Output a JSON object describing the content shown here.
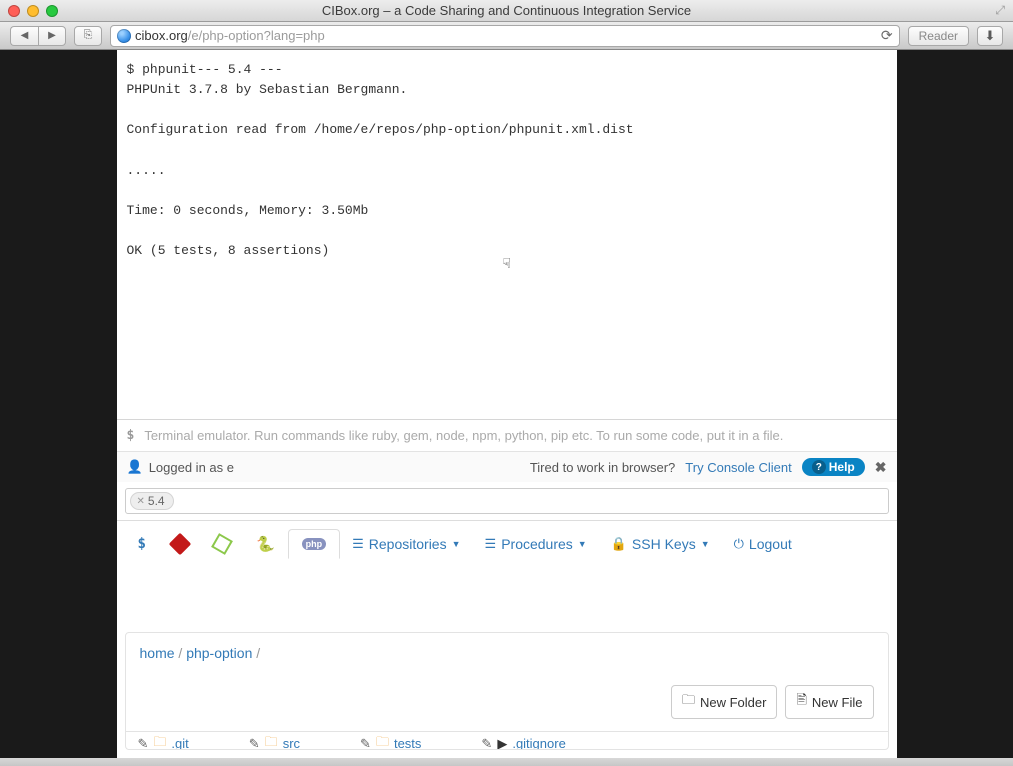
{
  "window": {
    "title": "CIBox.org – a Code Sharing and Continuous Integration Service"
  },
  "browser": {
    "url_host": "cibox.org",
    "url_path": "/e/php-option?lang=php",
    "reader_label": "Reader"
  },
  "terminal": {
    "output": "$ phpunit--- 5.4 ---\nPHPUnit 3.7.8 by Sebastian Bergmann.\n\nConfiguration read from /home/e/repos/php-option/phpunit.xml.dist\n\n.....\n\nTime: 0 seconds, Memory: 3.50Mb\n\nOK (5 tests, 8 assertions)",
    "prompt": "$",
    "placeholder": "Terminal emulator. Run commands like ruby, gem, node, npm, python, pip etc. To run some code, put it in a file."
  },
  "status": {
    "logged_in": "Logged in as e",
    "tired": "Tired to work in browser?",
    "try_link": "Try Console Client",
    "help_label": "Help"
  },
  "tag": {
    "value": "5.4"
  },
  "toolbar": {
    "dollar": "$",
    "repos": "Repositories",
    "procedures": "Procedures",
    "ssh": "SSH Keys",
    "logout": "Logout"
  },
  "breadcrumb": {
    "home": "home",
    "current": "php-option"
  },
  "buttons": {
    "new_folder": "New Folder",
    "new_file": "New File"
  },
  "folders": {
    "git": ".git",
    "src": "src",
    "tests": "tests",
    "gitignore": ".gitignore"
  }
}
